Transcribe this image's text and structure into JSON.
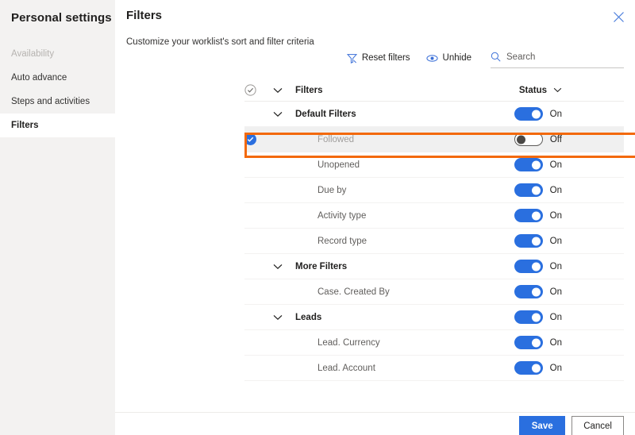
{
  "sidebar": {
    "title": "Personal settings",
    "items": [
      {
        "label": "Availability",
        "state": "disabled"
      },
      {
        "label": "Auto advance",
        "state": "normal"
      },
      {
        "label": "Steps and activities",
        "state": "normal"
      },
      {
        "label": "Filters",
        "state": "selected"
      }
    ]
  },
  "panel": {
    "title": "Filters",
    "subtitle": "Customize your worklist's sort and filter criteria",
    "close_icon": "close-icon"
  },
  "commandbar": {
    "reset_filters": {
      "label": "Reset filters",
      "icon": "filter-reset-icon"
    },
    "unhide": {
      "label": "Unhide",
      "icon": "eye-icon"
    },
    "search": {
      "placeholder": "Search",
      "icon": "search-icon"
    }
  },
  "table": {
    "header": {
      "select_all_icon": "check-circle-icon",
      "expand_icon": "chevron-down-icon",
      "filters_label": "Filters",
      "status_label": "Status",
      "status_sort_icon": "chevron-down-icon"
    },
    "rows": [
      {
        "label": "Default Filters",
        "type": "group",
        "status": "On",
        "toggle": "on",
        "checked": false,
        "highlighted": false
      },
      {
        "label": "Followed",
        "type": "child",
        "status": "Off",
        "toggle": "off",
        "checked": true,
        "highlighted": true
      },
      {
        "label": "Unopened",
        "type": "child",
        "status": "On",
        "toggle": "on",
        "checked": false,
        "highlighted": false
      },
      {
        "label": "Due by",
        "type": "child",
        "status": "On",
        "toggle": "on",
        "checked": false,
        "highlighted": false
      },
      {
        "label": "Activity type",
        "type": "child",
        "status": "On",
        "toggle": "on",
        "checked": false,
        "highlighted": false
      },
      {
        "label": "Record type",
        "type": "child",
        "status": "On",
        "toggle": "on",
        "checked": false,
        "highlighted": false
      },
      {
        "label": "More Filters",
        "type": "group",
        "status": "On",
        "toggle": "on",
        "checked": false,
        "highlighted": false
      },
      {
        "label": "Case. Created By",
        "type": "child",
        "status": "On",
        "toggle": "on",
        "checked": false,
        "highlighted": false
      },
      {
        "label": "Leads",
        "type": "group",
        "status": "On",
        "toggle": "on",
        "checked": false,
        "highlighted": false
      },
      {
        "label": "Lead. Currency",
        "type": "child",
        "status": "On",
        "toggle": "on",
        "checked": false,
        "highlighted": false
      },
      {
        "label": "Lead. Account",
        "type": "child",
        "status": "On",
        "toggle": "on",
        "checked": false,
        "highlighted": false
      }
    ]
  },
  "footer": {
    "save_label": "Save",
    "cancel_label": "Cancel"
  },
  "colors": {
    "accent_blue": "#2a6fdf",
    "highlight_orange": "#f3690b",
    "sidebar_bg": "#f3f2f1",
    "row_highlight_bg": "#f0f0f0"
  }
}
